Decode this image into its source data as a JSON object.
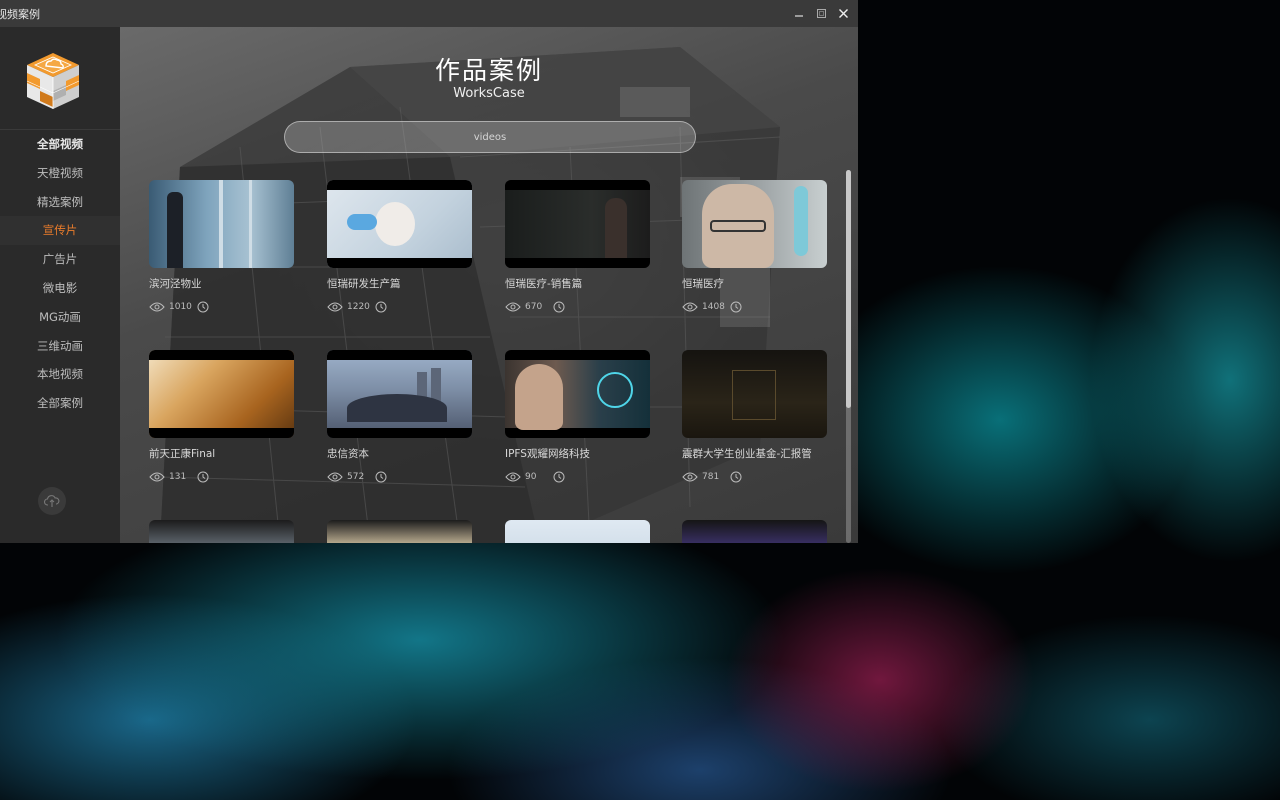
{
  "window": {
    "title": "视频案例",
    "controls": [
      "minimize-icon",
      "maximize-icon",
      "close-icon"
    ]
  },
  "sidebar": {
    "logo_icon": "cube-cloud-logo-icon",
    "items": [
      {
        "label": "全部视频",
        "state": "bold"
      },
      {
        "label": "天橙视频",
        "state": "normal"
      },
      {
        "label": "精选案例",
        "state": "normal"
      },
      {
        "label": "宣传片",
        "state": "active"
      },
      {
        "label": "广告片",
        "state": "normal"
      },
      {
        "label": "微电影",
        "state": "normal"
      },
      {
        "label": "MG动画",
        "state": "normal"
      },
      {
        "label": "三维动画",
        "state": "normal"
      },
      {
        "label": "本地视频",
        "state": "normal"
      },
      {
        "label": "全部案例",
        "state": "normal"
      }
    ],
    "upload_icon": "cloud-upload-icon"
  },
  "main": {
    "heading": "作品案例",
    "subheading": "WorksCase",
    "search_placeholder": "videos"
  },
  "cards": [
    {
      "title": "滨河泾物业",
      "views": "1010"
    },
    {
      "title": "恒瑞研发生产篇",
      "views": "1220"
    },
    {
      "title": "恒瑞医疗-销售篇",
      "views": "670"
    },
    {
      "title": "恒瑞医疗",
      "views": "1408"
    },
    {
      "title": "前天正康Final",
      "views": "131"
    },
    {
      "title": "忠信资本",
      "views": "572"
    },
    {
      "title": "IPFS观耀网络科技",
      "views": "90"
    },
    {
      "title": "震群大学生创业基金-汇报管",
      "views": "781"
    },
    {
      "title": "",
      "views": ""
    },
    {
      "title": "",
      "views": ""
    },
    {
      "title": "",
      "views": ""
    },
    {
      "title": "",
      "views": ""
    }
  ],
  "colors": {
    "accent": "#ec7d2b",
    "sidebar_bg": "#2a2a2a",
    "titlebar_bg": "#3a3a3a"
  }
}
